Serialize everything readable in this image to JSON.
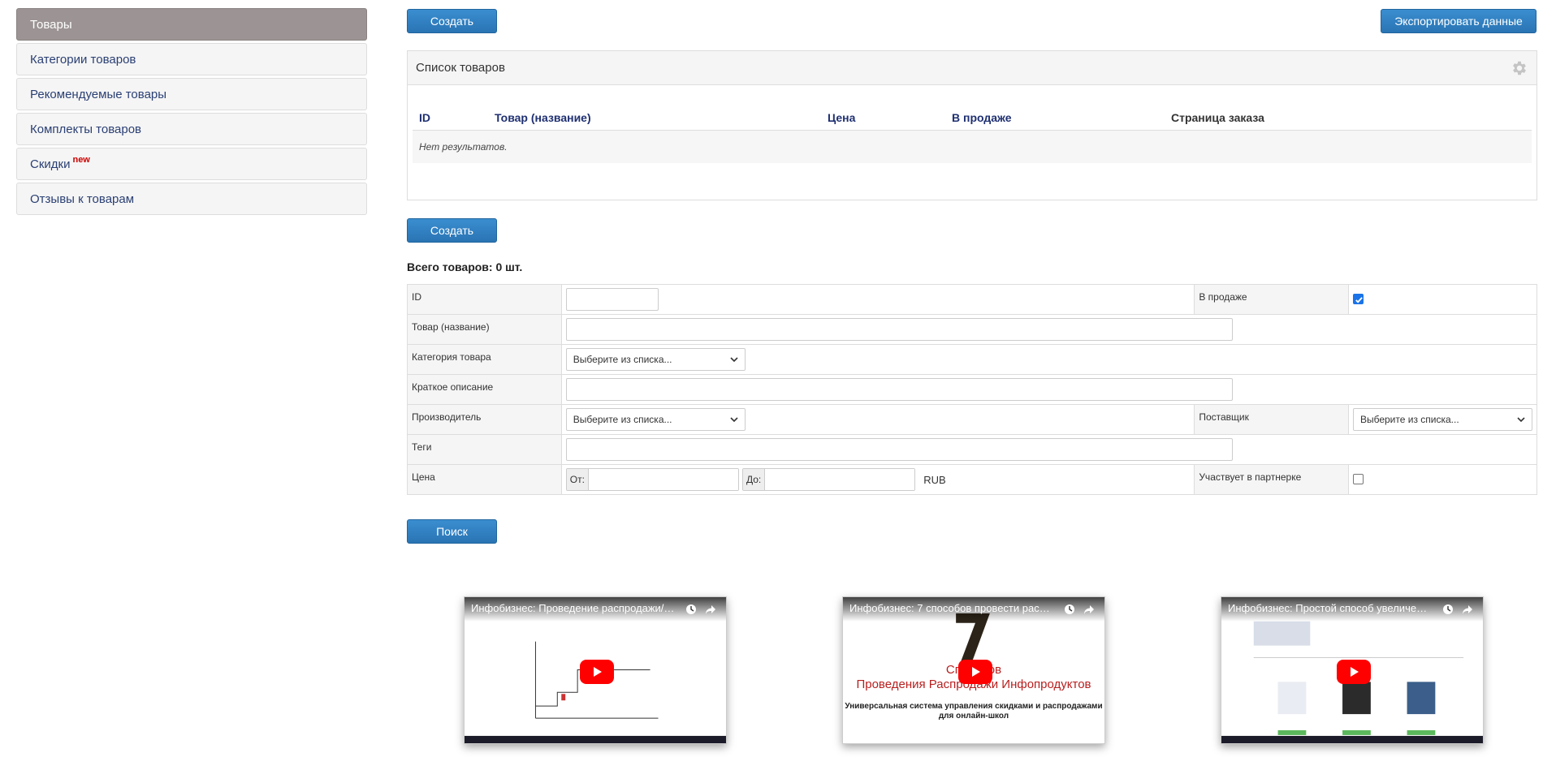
{
  "sidebar": {
    "items": [
      {
        "label": "Товары",
        "active": true
      },
      {
        "label": "Категории товаров"
      },
      {
        "label": "Рекомендуемые товары"
      },
      {
        "label": "Комплекты товаров"
      },
      {
        "label": "Скидки",
        "badge": "new"
      },
      {
        "label": "Отзывы к товарам"
      }
    ]
  },
  "toolbar": {
    "create_label": "Создать",
    "export_label": "Экспортировать данные"
  },
  "list_panel": {
    "title": "Список товаров",
    "columns": [
      "ID",
      "Товар (название)",
      "Цена",
      "В продаже",
      "Страница заказа"
    ],
    "empty_text": "Нет результатов."
  },
  "bottom_create_label": "Создать",
  "total_text": "Всего товаров: 0 шт.",
  "filter": {
    "id_label": "ID",
    "on_sale_label": "В продаже",
    "on_sale_checked": true,
    "name_label": "Товар (название)",
    "category_label": "Категория товара",
    "category_value": "Выберите из списка...",
    "short_desc_label": "Краткое описание",
    "manufacturer_label": "Производитель",
    "manufacturer_value": "Выберите из списка...",
    "supplier_label": "Поставщик",
    "supplier_value": "Выберите из списка...",
    "tags_label": "Теги",
    "price_label": "Цена",
    "price_from_label": "От:",
    "price_to_label": "До:",
    "currency": "RUB",
    "affiliate_label": "Участвует в партнерке",
    "affiliate_checked": false
  },
  "search_label": "Поиск",
  "videos": [
    {
      "title": "Инфобизнес: Проведение распродажи/зап..."
    },
    {
      "title": "Инфобизнес: 7 способов провести распрод...",
      "line1": "Способов",
      "line2": "Проведения Распродажи Инфопродуктов",
      "line3": "Универсальная система управления скидками и распродажами",
      "line4": "для онлайн-школ"
    },
    {
      "title": "Инфобизнес: Простой способ увеличения ..."
    }
  ],
  "colors": {
    "accent": "#2a74b3",
    "sidebar_active": "#9c9494",
    "link": "#2a3f73"
  }
}
